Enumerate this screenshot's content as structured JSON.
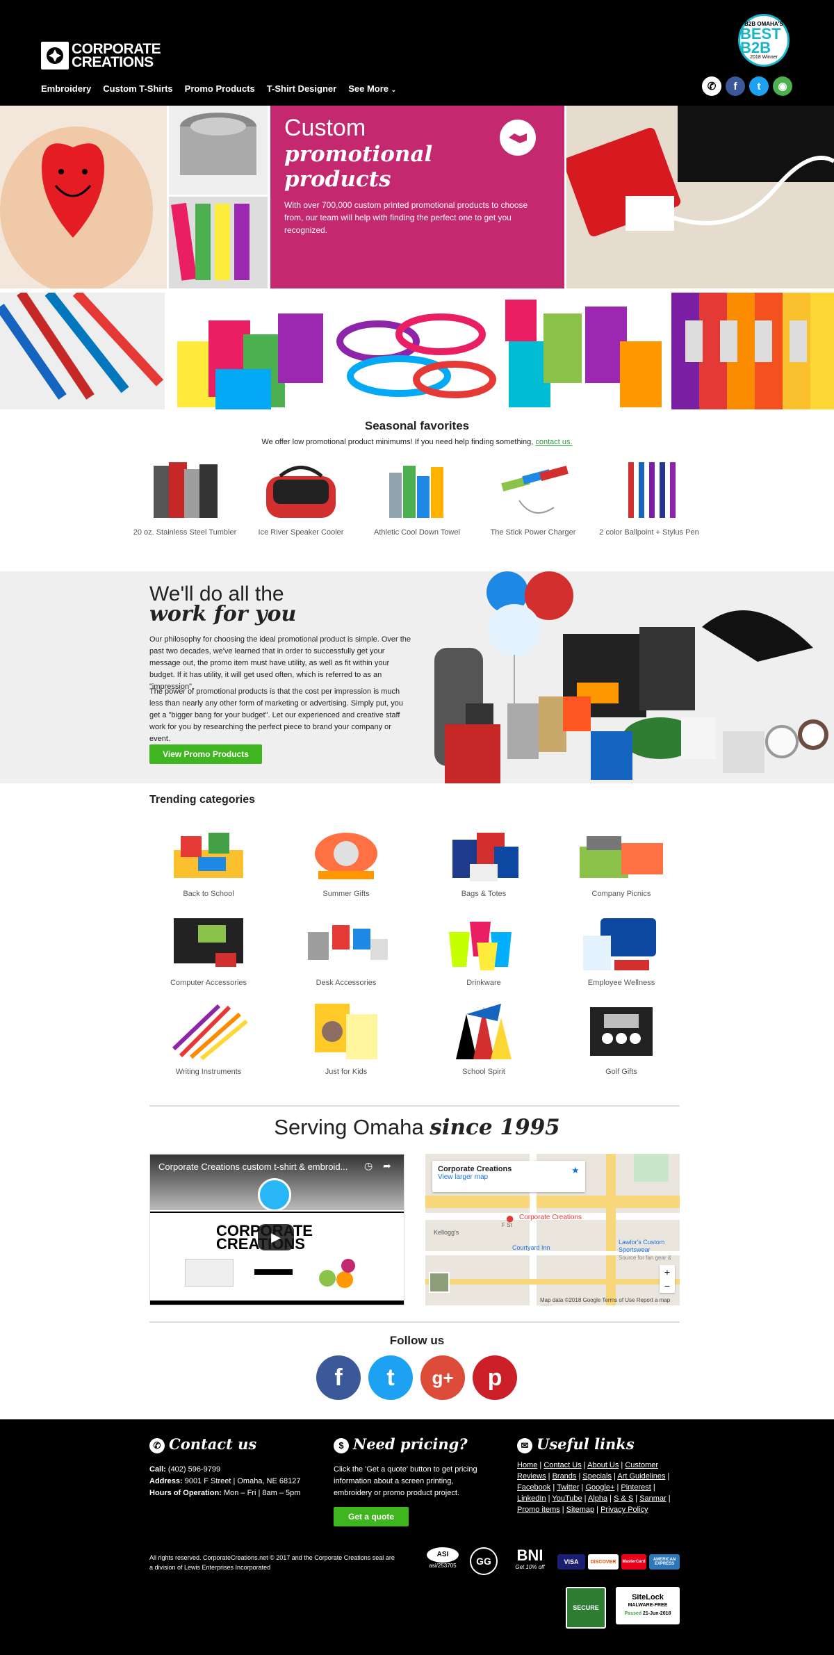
{
  "header": {
    "logo_line1": "CORPORATE",
    "logo_line2": "CREATIONS",
    "nav": [
      "Embroidery",
      "Custom T-Shirts",
      "Promo Products",
      "T-Shirt Designer",
      "See More"
    ],
    "badge": {
      "top": "B2B OMAHA'S",
      "main": "BEST B2B",
      "bottom": "2018 Winner"
    },
    "social": [
      "phone-icon",
      "facebook-icon",
      "twitter-icon",
      "google-maps-icon"
    ]
  },
  "hero": {
    "title1": "Custom",
    "title2": "promotional",
    "title3": "products",
    "text": "With over 700,000 custom printed promotional products to choose from, our team will help with finding the perfect one to get you recognized."
  },
  "seasonal": {
    "title": "Seasonal favorites",
    "sub_text": "We offer low promotional product minimums! If you need help finding something,",
    "sub_link": "contact us.",
    "items": [
      "20 oz. Stainless Steel Tumbler",
      "Ice River Speaker Cooler",
      "Athletic Cool Down Towel",
      "The Stick Power Charger",
      "2 color Ballpoint + Stylus Pen"
    ]
  },
  "promo": {
    "title1": "We'll do all the",
    "title2": "work for you",
    "p1": "Our philosophy for choosing the ideal promotional product is simple. Over the past two decades, we've learned that in order to successfully get your message out, the promo item must have utility, as well as fit within your budget. If it has utility, it will get used often, which is referred to as an \"impression\".",
    "p2": "The power of promotional products is that the cost per impression is much less than nearly any other form of marketing or advertising. Simply put, you get a \"bigger bang for your budget\". Let our experienced and creative staff work for you by researching the perfect piece to brand your company or event.",
    "button": "View Promo Products"
  },
  "trending": {
    "title": "Trending categories",
    "items": [
      "Back to School",
      "Summer Gifts",
      "Bags & Totes",
      "Company Picnics",
      "Computer Accessories",
      "Desk Accessories",
      "Drinkware",
      "Employee Wellness",
      "Writing Instruments",
      "Just for Kids",
      "School Spirit",
      "Golf Gifts"
    ]
  },
  "serving": {
    "t1": "Serving Omaha ",
    "t2": "since 1995",
    "video_title": "Corporate Creations custom t-shirt & embroid...",
    "map_name": "Corporate Creations",
    "map_link": "View larger map",
    "map_pin": "Corporate Creations",
    "map_labels": [
      "Kellogg's",
      "Courtyard Inn",
      "Lawlor's Custom Sportswear",
      "Source for fan gear &",
      "F St"
    ],
    "map_footer": "Map data ©2018 Google   Terms of Use   Report a map error"
  },
  "follow": {
    "title": "Follow us",
    "icons": [
      "facebook-icon",
      "twitter-icon",
      "google-plus-icon",
      "pinterest-icon"
    ]
  },
  "footer": {
    "contact_title": "Contact us",
    "call_label": "Call:",
    "call": "(402) 596-9799",
    "address_label": "Address:",
    "address": "9001 F Street | Omaha, NE 68127",
    "hours_label": "Hours of Operation:",
    "hours": "Mon – Fri | 8am – 5pm",
    "pricing_title": "Need pricing?",
    "pricing_text": "Click the 'Get a quote' button to get pricing information about a screen printing, embroidery or promo product project.",
    "quote_button": "Get a quote",
    "links_title": "Useful links",
    "links": [
      "Home",
      "Contact Us",
      "About Us",
      "Customer Reviews",
      "Brands",
      "Specials",
      "Art Guidelines",
      "Facebook",
      "Twitter",
      "Google+",
      "Pinterest",
      "LinkedIn",
      "YouTube",
      "Alpha",
      "S & S",
      "Sanmar",
      "Promo items",
      "Sitemap",
      "Privacy Policy"
    ],
    "copyright": "All rights reserved. CorporateCreations.net © 2017 and the Corporate Creations seal are a division of Lewis Enterprises Incorporated",
    "asi": "asi/253705",
    "bni": "BNI",
    "bni_sub": "Get 10% off",
    "cards": [
      "VISA",
      "DISCOVER",
      "MasterCard",
      "AMERICAN EXPRESS"
    ],
    "secure": "SECURE",
    "sitelock": "SiteLock",
    "sitelock_sub": "MALWARE-FREE",
    "sitelock_passed": "Passed",
    "sitelock_date": "21-Jun-2018"
  }
}
